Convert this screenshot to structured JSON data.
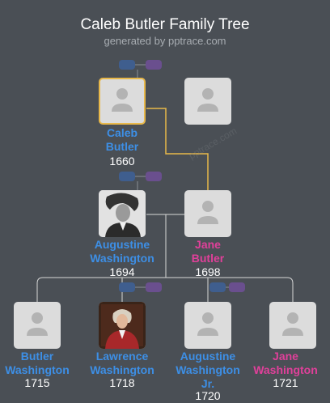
{
  "header": {
    "title": "Caleb Butler Family Tree",
    "subtitle": "generated by pptrace.com"
  },
  "watermark": "pptrace.com",
  "people": {
    "caleb": {
      "name_line1": "Caleb",
      "name_line2": "Butler",
      "year": "1660"
    },
    "augustine": {
      "name_line1": "Augustine",
      "name_line2": "Washington",
      "year": "1694"
    },
    "jane_butler": {
      "name_line1": "Jane",
      "name_line2": "Butler",
      "year": "1698"
    },
    "butler_w": {
      "name_line1": "Butler",
      "name_line2": "Washington",
      "year": "1715"
    },
    "lawrence_w": {
      "name_line1": "Lawrence",
      "name_line2": "Washington",
      "year": "1718"
    },
    "augustine_jr": {
      "name_line1": "Augustine",
      "name_line2": "Washington",
      "name_line3": "Jr.",
      "year": "1720"
    },
    "jane_w": {
      "name_line1": "Jane",
      "name_line2": "Washington",
      "year": "1721"
    }
  },
  "colors": {
    "background": "#4a4f55",
    "male": "#3d8fe6",
    "female": "#e0409a",
    "selected_border": "#e8b84a",
    "connector": "#e8b84a",
    "line": "#d8d8d8"
  }
}
